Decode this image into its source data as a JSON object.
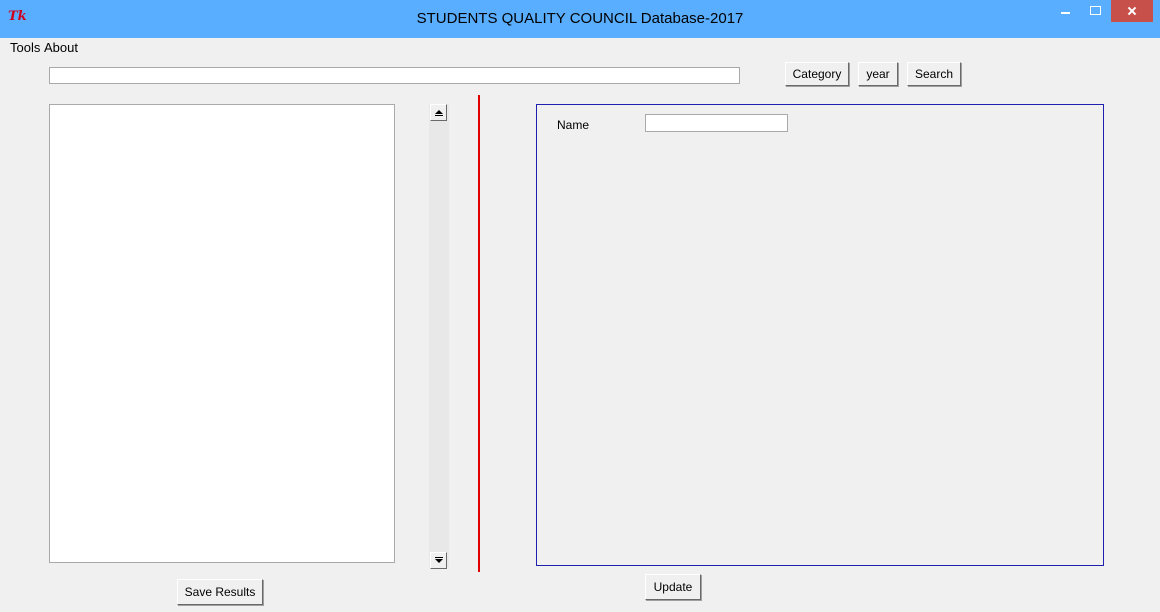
{
  "window": {
    "title": "STUDENTS QUALITY COUNCIL Database-2017",
    "app_icon_text": "Tk"
  },
  "menu": {
    "items": [
      {
        "label": "Tools"
      },
      {
        "label": "About"
      }
    ]
  },
  "search": {
    "value": "",
    "placeholder": ""
  },
  "toolbar": {
    "category_label": "Category",
    "year_label": "year",
    "search_label": "Search"
  },
  "results": {
    "items": []
  },
  "details": {
    "name_label": "Name",
    "name_value": ""
  },
  "actions": {
    "save_label": "Save Results",
    "update_label": "Update"
  },
  "colors": {
    "titlebar": "#5aaeff",
    "close_button": "#c7504a",
    "divider": "#e10000",
    "frame_border": "#2020b0",
    "background": "#f0f0f0"
  }
}
